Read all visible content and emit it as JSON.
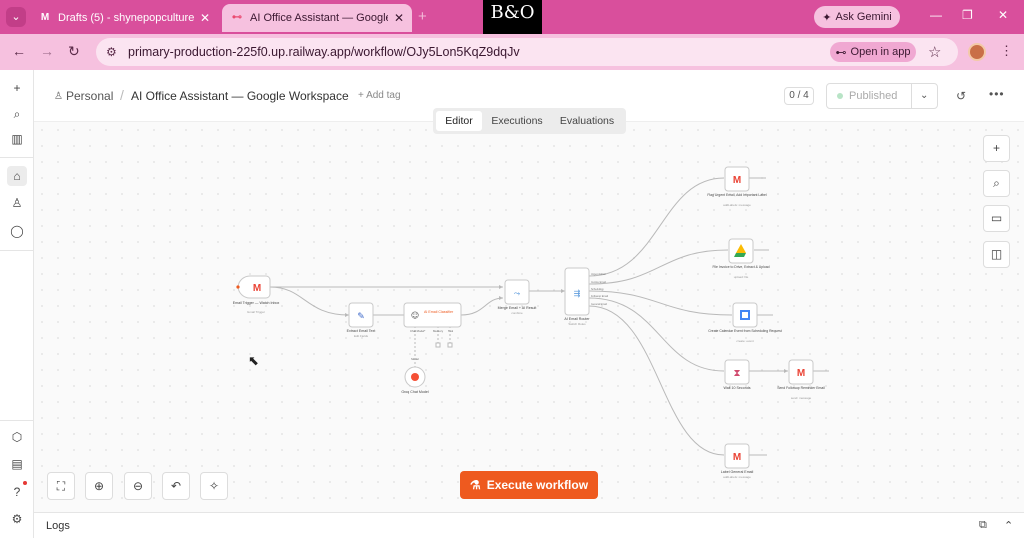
{
  "browser": {
    "tabs": [
      {
        "title": "Drafts (5) - shynepopculture@g",
        "icon": "gmail-icon",
        "active": false
      },
      {
        "title": "AI Office Assistant — Google",
        "icon": "n8n-icon",
        "active": true
      }
    ],
    "bo_logo": "B&O",
    "gemini_label": "Ask Gemini",
    "url": "primary-production-225f0.up.railway.app/workflow/OJy5Lon5KqZ9dqJv",
    "open_in_app": "Open in app"
  },
  "header": {
    "breadcrumb_personal": "Personal",
    "workflow_title": "AI Office Assistant — Google Workspace",
    "add_tag": "+ Add tag",
    "counter": "0 / 4",
    "publish_label": "Published"
  },
  "modes": [
    "Editor",
    "Executions",
    "Evaluations"
  ],
  "execute_label": "Execute workflow",
  "logs_label": "Logs",
  "nodes": {
    "trigger": {
      "title": "Email Trigger — Watch Inbox",
      "sub": "Gmail Trigger"
    },
    "extract": {
      "title": "Extract Email Text",
      "sub": "Edit Fields"
    },
    "classifier": {
      "title": "AI Email Classifier",
      "sub": ""
    },
    "groq": {
      "title": "Groq Chat Model",
      "sub": ""
    },
    "merge": {
      "title": "Merge Email + AI Result",
      "sub": "combine"
    },
    "router": {
      "title": "AI Email Router",
      "sub": "Switch Rules"
    },
    "flag": {
      "title": "Flag Urgent Email, Add Important Label",
      "sub": "addLabels: message"
    },
    "drive": {
      "title": "File Invoice to Drive, Extract & Upload",
      "sub": "upload: file"
    },
    "calendar": {
      "title": "Create Calendar Event from Scheduling Request",
      "sub": "create: event"
    },
    "wait": {
      "title": "Wait 10 Seconds",
      "sub": ""
    },
    "followup": {
      "title": "Send Followup Reminder Email",
      "sub": "send: message"
    },
    "general": {
      "title": "Label General Email",
      "sub": "addLabels: message"
    }
  },
  "router_outputs": [
    "Urgent Email",
    "Invoice Email",
    "Scheduling",
    "Followup Email",
    "General Email"
  ],
  "classifier_ports": [
    "Chat Model*",
    "Memory",
    "Tool"
  ],
  "model_port": "Model"
}
